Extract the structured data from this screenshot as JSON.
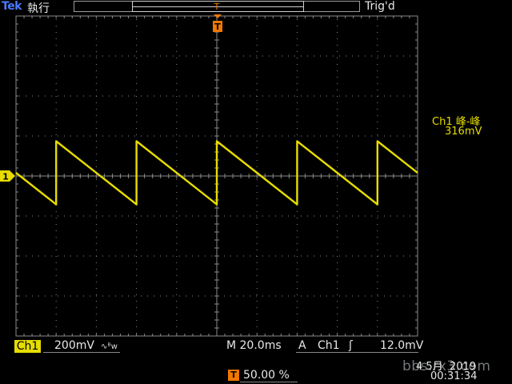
{
  "top_bar": {
    "brand": "Tek",
    "run_status": "執行",
    "trig_status": "Trig'd",
    "trig_pos_marker": "T"
  },
  "screen": {
    "trigger_marker": "T",
    "ch1_ground_marker": "1",
    "colors": {
      "ch1": "#e6dc00",
      "trigger": "#f07800",
      "grid": "#8a8a8a",
      "background": "#000000"
    }
  },
  "measurement": {
    "label": "Ch1 峰-峰",
    "value": "316mV"
  },
  "bottom_bar": {
    "ch1_tag": "Ch1",
    "ch1_scale": "200mV",
    "coupling_icon": "∿ᴮw",
    "timebase": "M 20.0ms",
    "trig_mode": "A",
    "trig_source": "Ch1",
    "trig_slope_icon": "ʃ",
    "trig_level": "12.0mV",
    "trig_pos_tag": "T",
    "trig_pos_value": "50.00 %",
    "date": "4 5月  2019",
    "time": "00:31:34"
  },
  "watermark": "bbs.rx3.com",
  "waveform": {
    "type": "sawtooth-falling",
    "period_ms": 40,
    "peak_to_peak_mV": 316,
    "volts_per_div_mV": 200,
    "time_per_div_ms": 20
  }
}
